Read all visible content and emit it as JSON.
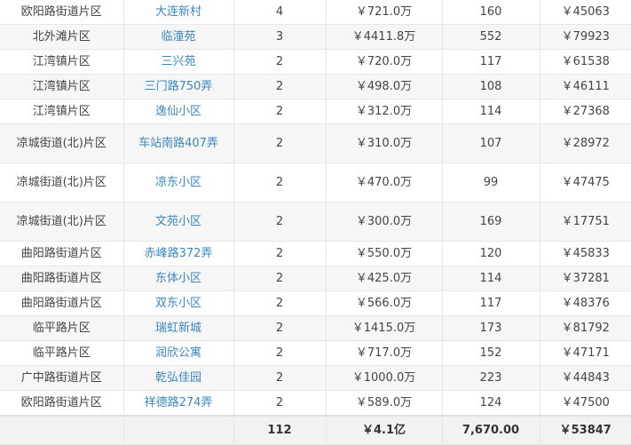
{
  "rows": [
    {
      "area": "欧阳路街道片区",
      "community": "大连新村",
      "count": "4",
      "total": "￥721.0万",
      "area_sqm": "160",
      "unit": "￥45063"
    },
    {
      "area": "北外滩片区",
      "community": "临潼苑",
      "count": "3",
      "total": "￥4411.8万",
      "area_sqm": "552",
      "unit": "￥79923"
    },
    {
      "area": "江湾镇片区",
      "community": "三兴苑",
      "count": "2",
      "total": "￥720.0万",
      "area_sqm": "117",
      "unit": "￥61538"
    },
    {
      "area": "江湾镇片区",
      "community": "三门路750弄",
      "count": "2",
      "total": "￥498.0万",
      "area_sqm": "108",
      "unit": "￥46111"
    },
    {
      "area": "江湾镇片区",
      "community": "逸仙小区",
      "count": "2",
      "total": "￥312.0万",
      "area_sqm": "114",
      "unit": "￥27368"
    },
    {
      "area": "凉城街道(北)片区",
      "community": "车站南路407弄",
      "count": "2",
      "total": "￥310.0万",
      "area_sqm": "107",
      "unit": "￥28972"
    },
    {
      "area": "凉城街道(北)片区",
      "community": "凉东小区",
      "count": "2",
      "total": "￥470.0万",
      "area_sqm": "99",
      "unit": "￥47475"
    },
    {
      "area": "凉城街道(北)片区",
      "community": "文苑小区",
      "count": "2",
      "total": "￥300.0万",
      "area_sqm": "169",
      "unit": "￥17751"
    },
    {
      "area": "曲阳路街道片区",
      "community": "赤峰路372弄",
      "count": "2",
      "total": "￥550.0万",
      "area_sqm": "120",
      "unit": "￥45833"
    },
    {
      "area": "曲阳路街道片区",
      "community": "东体小区",
      "count": "2",
      "total": "￥425.0万",
      "area_sqm": "114",
      "unit": "￥37281"
    },
    {
      "area": "曲阳路街道片区",
      "community": "双东小区",
      "count": "2",
      "total": "￥566.0万",
      "area_sqm": "117",
      "unit": "￥48376"
    },
    {
      "area": "临平路片区",
      "community": "瑞虹新城",
      "count": "2",
      "total": "￥1415.0万",
      "area_sqm": "173",
      "unit": "￥81792"
    },
    {
      "area": "临平路片区",
      "community": "润欣公寓",
      "count": "2",
      "total": "￥717.0万",
      "area_sqm": "152",
      "unit": "￥47171"
    },
    {
      "area": "广中路街道片区",
      "community": "乾弘佳园",
      "count": "2",
      "total": "￥1000.0万",
      "area_sqm": "223",
      "unit": "￥44843"
    },
    {
      "area": "欧阳路街道片区",
      "community": "祥德路274弄",
      "count": "2",
      "total": "￥589.0万",
      "area_sqm": "124",
      "unit": "￥47500"
    }
  ],
  "totals": {
    "area": "",
    "community": "",
    "count": "112",
    "total": "￥4.1亿",
    "area_sqm": "7,670.00",
    "unit": "￥53847"
  },
  "colors": {
    "link": "#3a86c0",
    "stripe": "#f6f6f6",
    "footer": "#f2f2f2"
  }
}
